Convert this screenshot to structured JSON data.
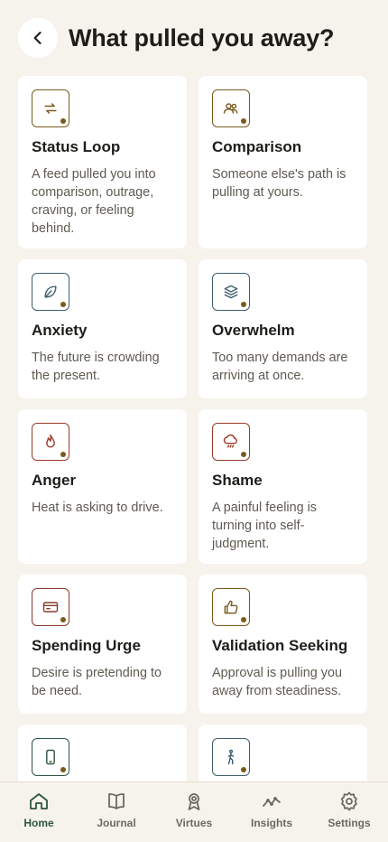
{
  "header": {
    "title": "What pulled you away?"
  },
  "cards": [
    {
      "title": "Status Loop",
      "desc": "A feed pulled you into comparison, outrage, craving, or feeling behind.",
      "icon": "repeat-icon",
      "color": "#7a5a1c"
    },
    {
      "title": "Comparison",
      "desc": "Someone else's path is pulling at yours.",
      "icon": "people-icon",
      "color": "#7a5a1c"
    },
    {
      "title": "Anxiety",
      "desc": "The future is crowding the present.",
      "icon": "leaf-icon",
      "color": "#3f5f6e"
    },
    {
      "title": "Overwhelm",
      "desc": "Too many demands are arriving at once.",
      "icon": "layers-icon",
      "color": "#3f5f6e"
    },
    {
      "title": "Anger",
      "desc": "Heat is asking to drive.",
      "icon": "flame-icon",
      "color": "#9a3b2a"
    },
    {
      "title": "Shame",
      "desc": "A painful feeling is turning into self-judgment.",
      "icon": "cloud-rain-icon",
      "color": "#9a3b2a"
    },
    {
      "title": "Spending Urge",
      "desc": "Desire is pretending to be need.",
      "icon": "credit-card-icon",
      "color": "#8a3a2c"
    },
    {
      "title": "Validation Seeking",
      "desc": "Approval is pulling you away from steadiness.",
      "icon": "thumbs-up-icon",
      "color": "#7a5a1c"
    },
    {
      "title": "",
      "desc": "",
      "icon": "phone-icon",
      "color": "#2f5642"
    },
    {
      "title": "",
      "desc": "",
      "icon": "walking-person-icon",
      "color": "#3f5f6e"
    }
  ],
  "nav": {
    "active": "Home",
    "accent": "#2f5642",
    "items": [
      {
        "label": "Home",
        "icon": "home-icon"
      },
      {
        "label": "Journal",
        "icon": "book-icon"
      },
      {
        "label": "Virtues",
        "icon": "award-icon"
      },
      {
        "label": "Insights",
        "icon": "trend-icon"
      },
      {
        "label": "Settings",
        "icon": "gear-icon"
      }
    ]
  }
}
